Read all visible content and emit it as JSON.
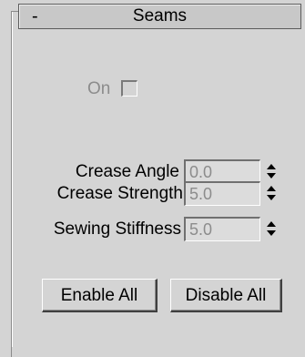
{
  "rollout": {
    "toggle": "-",
    "title": "Seams"
  },
  "on": {
    "label": "On",
    "checked": false,
    "enabled": false
  },
  "fields": [
    {
      "label": "Crease Angle",
      "value": "0.0"
    },
    {
      "label": "Crease Strength",
      "value": "5.0"
    },
    {
      "label": "Sewing Stiffness",
      "value": "5.0"
    }
  ],
  "buttons": {
    "enable_all": "Enable All",
    "disable_all": "Disable All"
  },
  "icons": {
    "spinner": "spinner-up-down-arrows"
  }
}
